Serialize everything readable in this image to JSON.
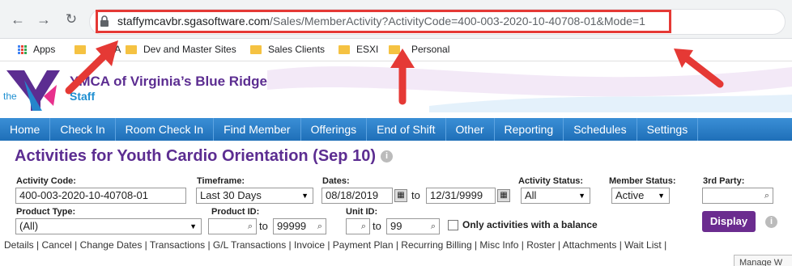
{
  "browser": {
    "url_host": "staffymcavbr.sgasoftware.com",
    "url_path": "/Sales/MemberActivity?ActivityCode=400-003-2020-10-40708-01&Mode=1",
    "back_icon": "arrow-left-icon",
    "forward_icon": "arrow-right-icon",
    "reload_icon": "reload-icon"
  },
  "bookmarks": [
    {
      "label": "Apps"
    },
    {
      "label": "GA"
    },
    {
      "label": "Dev and Master Sites"
    },
    {
      "label": "Sales Clients"
    },
    {
      "label": "ESXI"
    },
    {
      "label": "Personal"
    }
  ],
  "site": {
    "logo_text": "the",
    "name": "YMCA of Virginia’s Blue Ridge",
    "sub": "Staff"
  },
  "nav": [
    "Home",
    "Check In",
    "Room Check In",
    "Find Member",
    "Offerings",
    "End of Shift",
    "Other",
    "Reporting",
    "Schedules",
    "Settings"
  ],
  "page": {
    "title": "Activities for Youth Cardio Orientation (Sep 10)"
  },
  "filters": {
    "activity_code_label": "Activity Code:",
    "activity_code_value": "400-003-2020-10-40708-01",
    "timeframe_label": "Timeframe:",
    "timeframe_value": "Last 30 Days",
    "dates_label": "Dates:",
    "date_from": "08/18/2019",
    "to_text": "to",
    "date_to": "12/31/9999",
    "activity_status_label": "Activity Status:",
    "activity_status_value": "All",
    "member_status_label": "Member Status:",
    "member_status_value": "Active",
    "third_party_label": "3rd Party:",
    "third_party_value": "",
    "product_type_label": "Product Type:",
    "product_type_value": "(All)",
    "product_id_label": "Product ID:",
    "product_id_to_value": "99999",
    "unit_id_label": "Unit ID:",
    "unit_id_to_value": "99",
    "balance_only_label": "Only activities with a balance",
    "display_label": "Display"
  },
  "action_links": "Details | Cancel | Change Dates | Transactions | G/L Transactions | Invoice | Payment Plan | Recurring Billing | Misc Info | Roster | Attachments | Wait List |",
  "tooltip": "Manage W",
  "colors": {
    "accent": "#5c2d91",
    "nav": "#1f6fb8",
    "highlight": "#e53935"
  }
}
